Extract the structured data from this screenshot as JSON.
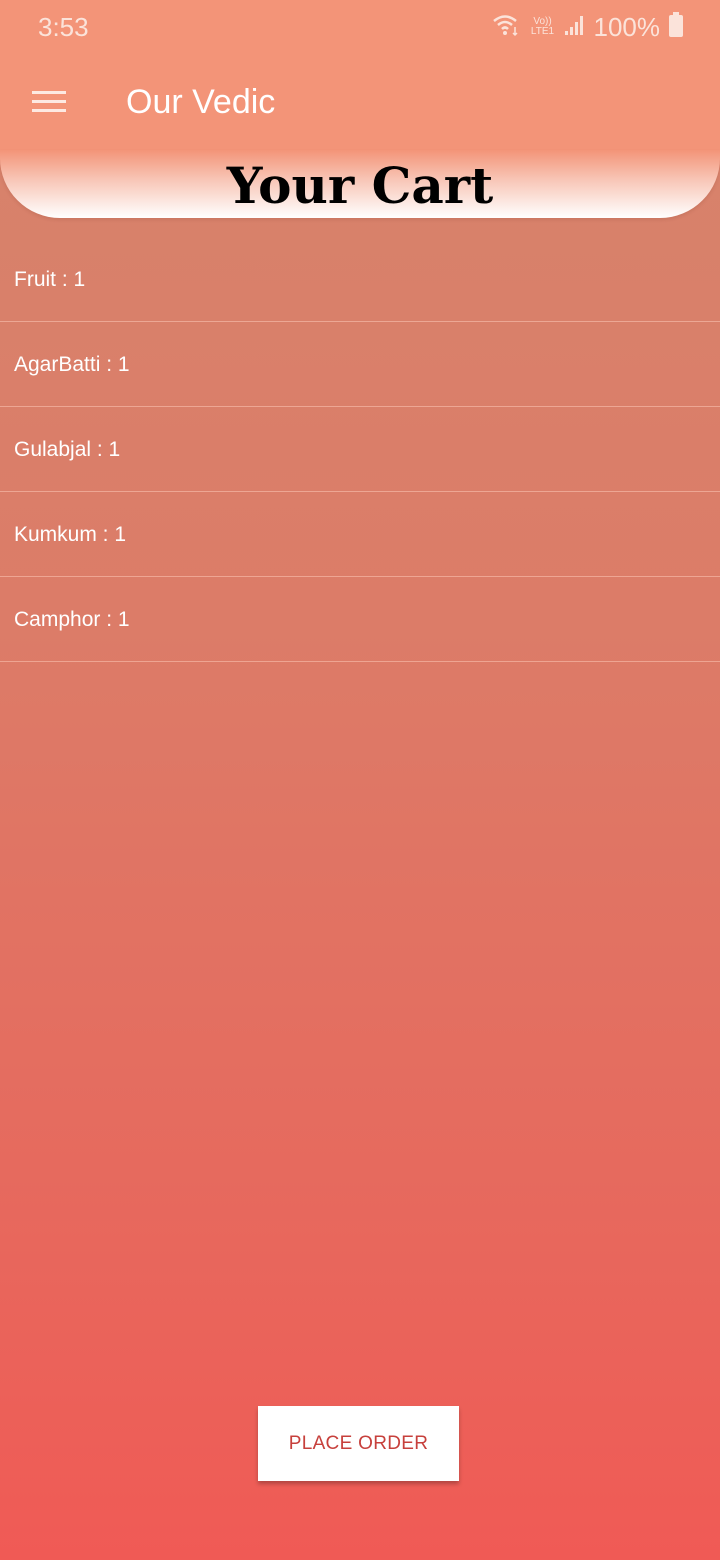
{
  "status_bar": {
    "time": "3:53",
    "network_badge": "Vo))\nLTE1",
    "battery": "100%",
    "icons": [
      "wifi-icon",
      "signal-icon",
      "battery-icon"
    ]
  },
  "app_bar": {
    "title": "Our Vedic",
    "menu_icon": "hamburger-menu-icon"
  },
  "cart": {
    "title": "Your Cart",
    "items": [
      {
        "label": "Fruit : 1"
      },
      {
        "label": "AgarBatti : 1"
      },
      {
        "label": "Gulabjal : 1"
      },
      {
        "label": "Kumkum : 1"
      },
      {
        "label": "Camphor : 1"
      }
    ]
  },
  "actions": {
    "place_order_label": "PLACE ORDER"
  },
  "colors": {
    "app_bar": "#f39478",
    "background_top": "#d6846c",
    "background_bottom": "#f05a55",
    "button_text": "#c7403c"
  }
}
